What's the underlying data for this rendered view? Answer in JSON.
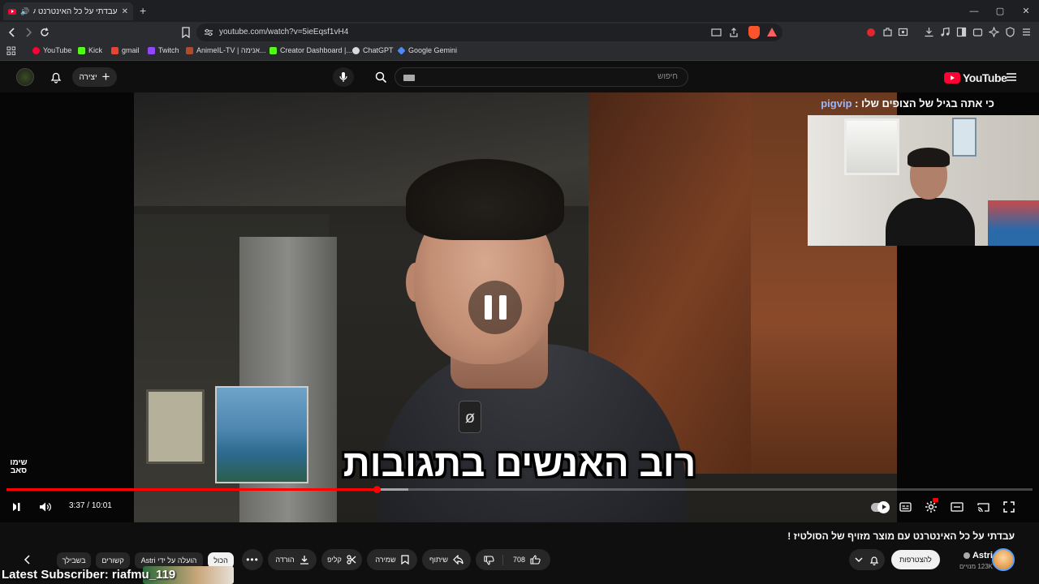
{
  "browser": {
    "tab_title": "עבדתי על כל האינטרנט עם מו...",
    "url": "youtube.com/watch?v=5ieEqsf1vH4",
    "window_controls": [
      "—",
      "▢",
      "✕"
    ],
    "bookmarks": [
      {
        "label": "YouTube",
        "color": "#ff0033"
      },
      {
        "label": "Kick",
        "color": "#53fc18"
      },
      {
        "label": "gmail",
        "color": "#ea4335"
      },
      {
        "label": "Twitch",
        "color": "#9146ff"
      },
      {
        "label": "AnimeIL-TV | אנימה...",
        "color": "#b04b2b"
      },
      {
        "label": "Creator Dashboard |...",
        "color": "#53fc18"
      },
      {
        "label": "ChatGPT",
        "color": "#d9d9d9"
      },
      {
        "label": "Google Gemini",
        "color": "#4c8bf5"
      }
    ]
  },
  "masthead": {
    "create_label": "יצירה",
    "search_placeholder": "חיפוש",
    "logo_text": "YouTube"
  },
  "player": {
    "caption": "רוב האנשים בתגובות",
    "webcam_label": "כי אתה בגיל של הצופים שלו :",
    "webcam_label_highlight": "pigvip",
    "watermark": "שימו סאב",
    "time_current": "3:37",
    "time_total": "10:01",
    "progress_fraction": 0.361,
    "buffer_fraction": 0.392
  },
  "video": {
    "title": "עבדתי על כל האינטרנט עם מוצר מזויף של הסולטיז !",
    "channel_name": "Astri",
    "channel_subs": "123K מנויים",
    "subscribe_label": "להצטרפות",
    "like_count": "708",
    "share_label": "שיתוף",
    "save_label": "שמירה",
    "clip_label": "קליפ",
    "download_label": "הורדה"
  },
  "chips": {
    "all": "הכול",
    "by_uploader": "הועלה על ידי Astri",
    "related": "קשורים",
    "for_you": "בשבילך"
  },
  "overlay": {
    "latest_subscriber": "Latest Subscriber: riafmu_119"
  }
}
